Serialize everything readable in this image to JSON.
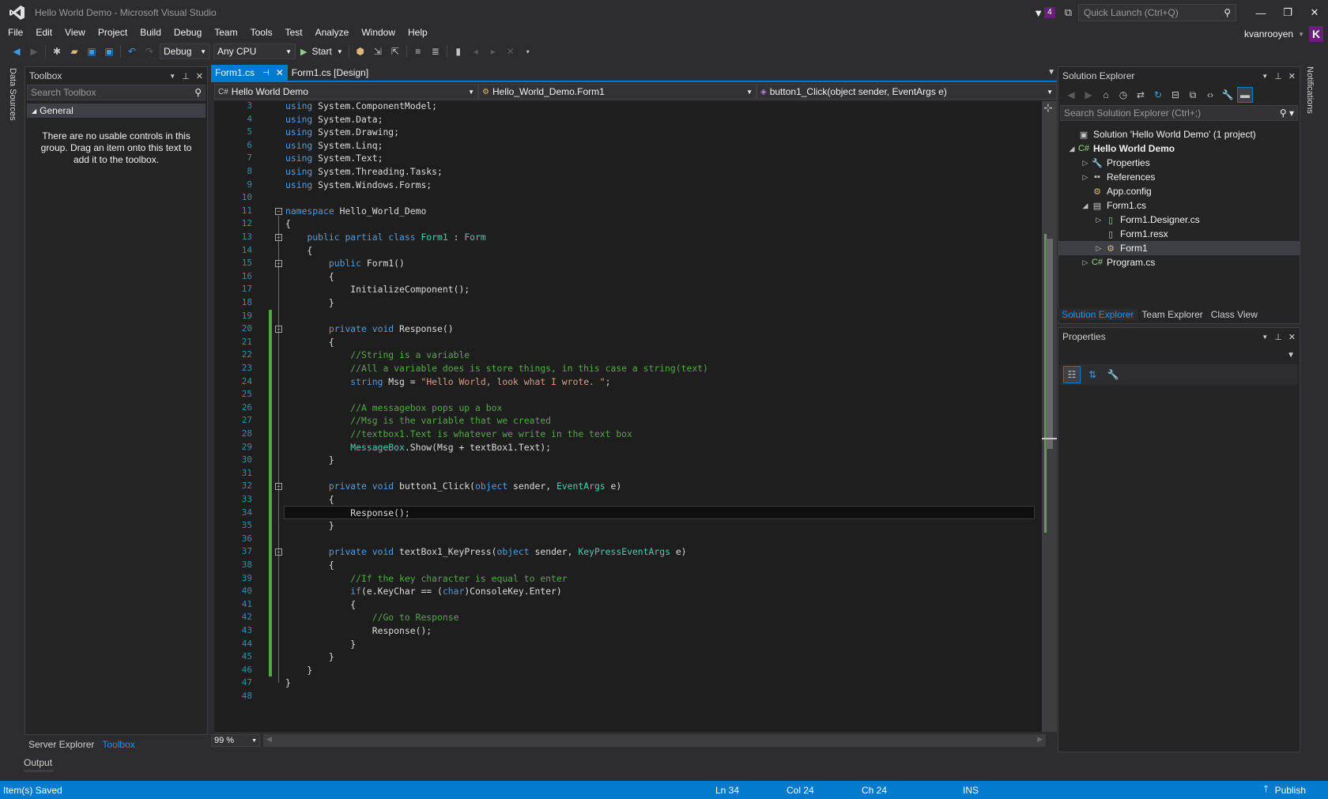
{
  "window": {
    "title": "Hello World Demo - Microsoft Visual Studio",
    "notification_count": "4",
    "quick_launch_placeholder": "Quick Launch (Ctrl+Q)",
    "account_name": "kvanrooyen",
    "account_initial": "K"
  },
  "menu": [
    "File",
    "Edit",
    "View",
    "Project",
    "Build",
    "Debug",
    "Team",
    "Tools",
    "Test",
    "Analyze",
    "Window",
    "Help"
  ],
  "toolbar": {
    "configuration": "Debug",
    "platform": "Any CPU",
    "start_label": "Start"
  },
  "left_strip": {
    "data_sources": "Data Sources"
  },
  "toolbox": {
    "title": "Toolbox",
    "search_placeholder": "Search Toolbox",
    "group": "General",
    "empty_message": "There are no usable controls in this group. Drag an item onto this text to add it to the toolbox."
  },
  "left_bottom_tabs": {
    "server_explorer": "Server Explorer",
    "toolbox": "Toolbox",
    "output": "Output"
  },
  "editor": {
    "tabs": [
      {
        "label": "Form1.cs",
        "active": true
      },
      {
        "label": "Form1.cs [Design]",
        "active": false
      }
    ],
    "nav": {
      "project": "Hello World Demo",
      "class": "Hello_World_Demo.Form1",
      "member": "button1_Click(object sender, EventArgs e)"
    },
    "zoom": "99 %",
    "first_line": 3,
    "current_line": 34,
    "lines": [
      [
        [
          "kw",
          "using"
        ],
        [
          "t",
          " System.ComponentModel;"
        ]
      ],
      [
        [
          "kw",
          "using"
        ],
        [
          "t",
          " System.Data;"
        ]
      ],
      [
        [
          "kw",
          "using"
        ],
        [
          "t",
          " System.Drawing;"
        ]
      ],
      [
        [
          "kw",
          "using"
        ],
        [
          "t",
          " System.Linq;"
        ]
      ],
      [
        [
          "kw",
          "using"
        ],
        [
          "t",
          " System.Text;"
        ]
      ],
      [
        [
          "kw",
          "using"
        ],
        [
          "t",
          " System.Threading.Tasks;"
        ]
      ],
      [
        [
          "kw",
          "using"
        ],
        [
          "t",
          " System.Windows.Forms;"
        ]
      ],
      [],
      [
        [
          "kw",
          "namespace"
        ],
        [
          "t",
          " Hello_World_Demo"
        ]
      ],
      [
        [
          "t",
          "{"
        ]
      ],
      [
        [
          "t",
          "    "
        ],
        [
          "kw",
          "public partial class"
        ],
        [
          "t",
          " "
        ],
        [
          "ty",
          "Form1"
        ],
        [
          "t",
          " : "
        ],
        [
          "ty",
          "Form"
        ]
      ],
      [
        [
          "t",
          "    {"
        ]
      ],
      [
        [
          "t",
          "        "
        ],
        [
          "kw",
          "public"
        ],
        [
          "t",
          " Form1()"
        ]
      ],
      [
        [
          "t",
          "        {"
        ]
      ],
      [
        [
          "t",
          "            InitializeComponent();"
        ]
      ],
      [
        [
          "t",
          "        }"
        ]
      ],
      [],
      [
        [
          "t",
          "        "
        ],
        [
          "kw",
          "private void"
        ],
        [
          "t",
          " Response()"
        ]
      ],
      [
        [
          "t",
          "        {"
        ]
      ],
      [
        [
          "t",
          "            "
        ],
        [
          "cm",
          "//String is a variable"
        ]
      ],
      [
        [
          "t",
          "            "
        ],
        [
          "cm",
          "//All a variable does is store things, in this case a string(text)"
        ]
      ],
      [
        [
          "t",
          "            "
        ],
        [
          "kw",
          "string"
        ],
        [
          "t",
          " Msg = "
        ],
        [
          "st",
          "\"Hello World, look what I wrote. \""
        ],
        [
          "t",
          ";"
        ]
      ],
      [],
      [
        [
          "t",
          "            "
        ],
        [
          "cm",
          "//A messagebox pops up a box"
        ]
      ],
      [
        [
          "t",
          "            "
        ],
        [
          "cm",
          "//Msg is the variable that we created"
        ]
      ],
      [
        [
          "t",
          "            "
        ],
        [
          "cm",
          "//textbox1.Text is whatever we write in the text box"
        ]
      ],
      [
        [
          "t",
          "            "
        ],
        [
          "ty",
          "MessageBox"
        ],
        [
          "t",
          ".Show(Msg + textBox1.Text);"
        ]
      ],
      [
        [
          "t",
          "        }"
        ]
      ],
      [],
      [
        [
          "t",
          "        "
        ],
        [
          "kw",
          "private void"
        ],
        [
          "t",
          " button1_Click("
        ],
        [
          "kw",
          "object"
        ],
        [
          "t",
          " sender, "
        ],
        [
          "ty",
          "EventArgs"
        ],
        [
          "t",
          " e)"
        ]
      ],
      [
        [
          "t",
          "        {"
        ]
      ],
      [
        [
          "t",
          "            Response();"
        ]
      ],
      [
        [
          "t",
          "        }"
        ]
      ],
      [],
      [
        [
          "t",
          "        "
        ],
        [
          "kw",
          "private void"
        ],
        [
          "t",
          " textBox1_KeyPress("
        ],
        [
          "kw",
          "object"
        ],
        [
          "t",
          " sender, "
        ],
        [
          "ty",
          "KeyPressEventArgs"
        ],
        [
          "t",
          " e)"
        ]
      ],
      [
        [
          "t",
          "        {"
        ]
      ],
      [
        [
          "t",
          "            "
        ],
        [
          "cm",
          "//If the key character is equal to enter"
        ]
      ],
      [
        [
          "t",
          "            "
        ],
        [
          "kw",
          "if"
        ],
        [
          "t",
          "(e.KeyChar == ("
        ],
        [
          "kw",
          "char"
        ],
        [
          "t",
          ")ConsoleKey.Enter)"
        ]
      ],
      [
        [
          "t",
          "            {"
        ]
      ],
      [
        [
          "t",
          "                "
        ],
        [
          "cm",
          "//Go to Response"
        ]
      ],
      [
        [
          "t",
          "                Response();"
        ]
      ],
      [
        [
          "t",
          "            }"
        ]
      ],
      [
        [
          "t",
          "        }"
        ]
      ],
      [
        [
          "t",
          "    }"
        ]
      ],
      [
        [
          "t",
          "}"
        ]
      ],
      []
    ]
  },
  "solution_explorer": {
    "title": "Solution Explorer",
    "search_placeholder": "Search Solution Explorer (Ctrl+;)",
    "tree": [
      {
        "label": "Solution 'Hello World Demo' (1 project)",
        "level": 0,
        "arrow": "",
        "icon": "solution-icon",
        "glyph": "▣",
        "bold": false
      },
      {
        "label": "Hello World Demo",
        "level": 0,
        "arrow": "◢",
        "icon": "csharp-project-icon",
        "glyph": "C#",
        "bold": true
      },
      {
        "label": "Properties",
        "level": 1,
        "arrow": "▷",
        "icon": "wrench-icon",
        "glyph": "🔧",
        "bold": false
      },
      {
        "label": "References",
        "level": 1,
        "arrow": "▷",
        "icon": "references-icon",
        "glyph": "▪▪",
        "bold": false
      },
      {
        "label": "App.config",
        "level": 1,
        "arrow": "",
        "icon": "config-file-icon",
        "glyph": "⚙",
        "bold": false
      },
      {
        "label": "Form1.cs",
        "level": 1,
        "arrow": "◢",
        "icon": "form-icon",
        "glyph": "▤",
        "bold": false
      },
      {
        "label": "Form1.Designer.cs",
        "level": 2,
        "arrow": "▷",
        "icon": "csharp-file-icon",
        "glyph": "▯",
        "bold": false
      },
      {
        "label": "Form1.resx",
        "level": 2,
        "arrow": "",
        "icon": "resx-file-icon",
        "glyph": "▯",
        "bold": false
      },
      {
        "label": "Form1",
        "level": 2,
        "arrow": "▷",
        "icon": "class-icon",
        "glyph": "⚙",
        "bold": false,
        "selected": true
      },
      {
        "label": "Program.cs",
        "level": 1,
        "arrow": "▷",
        "icon": "csharp-file-icon",
        "glyph": "C#",
        "bold": false
      }
    ],
    "tabs": [
      {
        "label": "Solution Explorer",
        "active": true
      },
      {
        "label": "Team Explorer",
        "active": false
      },
      {
        "label": "Class View",
        "active": false
      }
    ]
  },
  "properties": {
    "title": "Properties"
  },
  "right_strip": {
    "notifications": "Notifications"
  },
  "status": {
    "message": "Item(s) Saved",
    "ln": "Ln 34",
    "col": "Col 24",
    "ch": "Ch 24",
    "ins": "INS",
    "publish": "Publish"
  },
  "colors": {
    "accent": "#007acc",
    "brand": "#68217a",
    "keyword": "#569cd6",
    "type": "#4ec9b0",
    "comment": "#57a64a",
    "string": "#d69d85",
    "line_number": "#2b91af"
  }
}
